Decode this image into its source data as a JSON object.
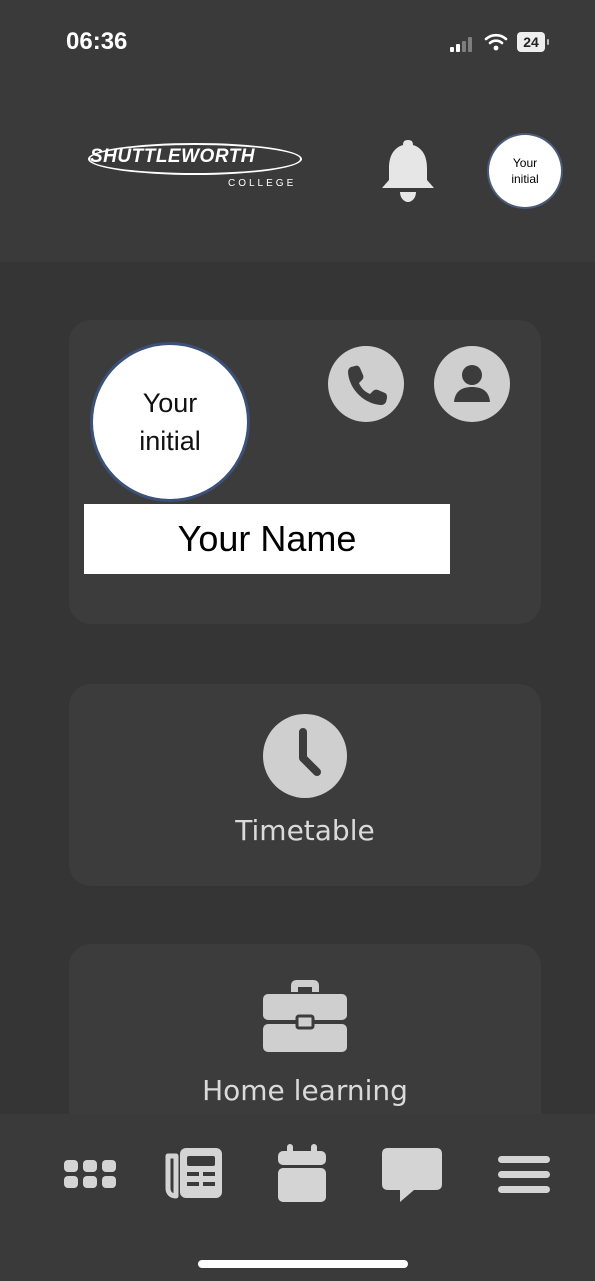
{
  "status_bar": {
    "time": "06:36",
    "battery": "24"
  },
  "header": {
    "logo": {
      "wordmark": "SHUTTLEWORTH",
      "subtitle": "COLLEGE"
    },
    "avatar_text": "Your initial"
  },
  "profile": {
    "avatar_text": "Your initial",
    "name": "Your Name"
  },
  "tiles": [
    {
      "label": "Timetable",
      "icon": "clock-icon"
    },
    {
      "label": "Home learning",
      "icon": "briefcase-icon"
    }
  ],
  "tab_bar": [
    {
      "icon": "grid-icon"
    },
    {
      "icon": "newspaper-icon"
    },
    {
      "icon": "calendar-icon"
    },
    {
      "icon": "chat-icon"
    },
    {
      "icon": "menu-icon"
    }
  ],
  "colors": {
    "background": "#353535",
    "panel": "#3c3c3c",
    "icon": "#cfcfcf",
    "avatar_border": "#3b5178"
  }
}
